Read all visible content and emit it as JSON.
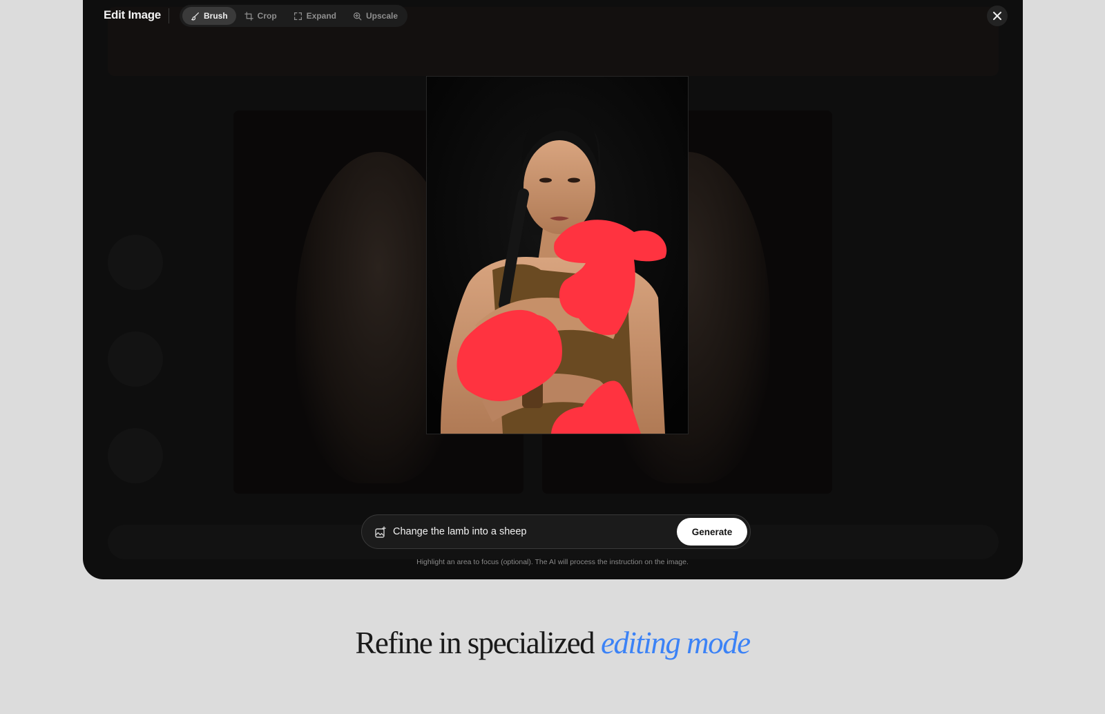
{
  "editor": {
    "title": "Edit Image",
    "tools": [
      {
        "label": "Brush",
        "icon": "brush-icon",
        "active": true
      },
      {
        "label": "Crop",
        "icon": "crop-icon",
        "active": false
      },
      {
        "label": "Expand",
        "icon": "expand-icon",
        "active": false
      },
      {
        "label": "Upscale",
        "icon": "upscale-icon",
        "active": false
      }
    ],
    "close_icon": "close-icon"
  },
  "prompt": {
    "value": "Change the lamb into a sheep",
    "icon": "image-edit-icon",
    "generate_label": "Generate"
  },
  "hint": "Highlight an area to focus (optional). The AI will process the instruction on the image.",
  "heading": {
    "main": "Refine in specialized",
    "accent": "editing mode"
  },
  "colors": {
    "accent": "#3b82f6",
    "mask": "#ff3340",
    "background": "#dcdcdc",
    "editor_bg": "#0e0e0e"
  }
}
